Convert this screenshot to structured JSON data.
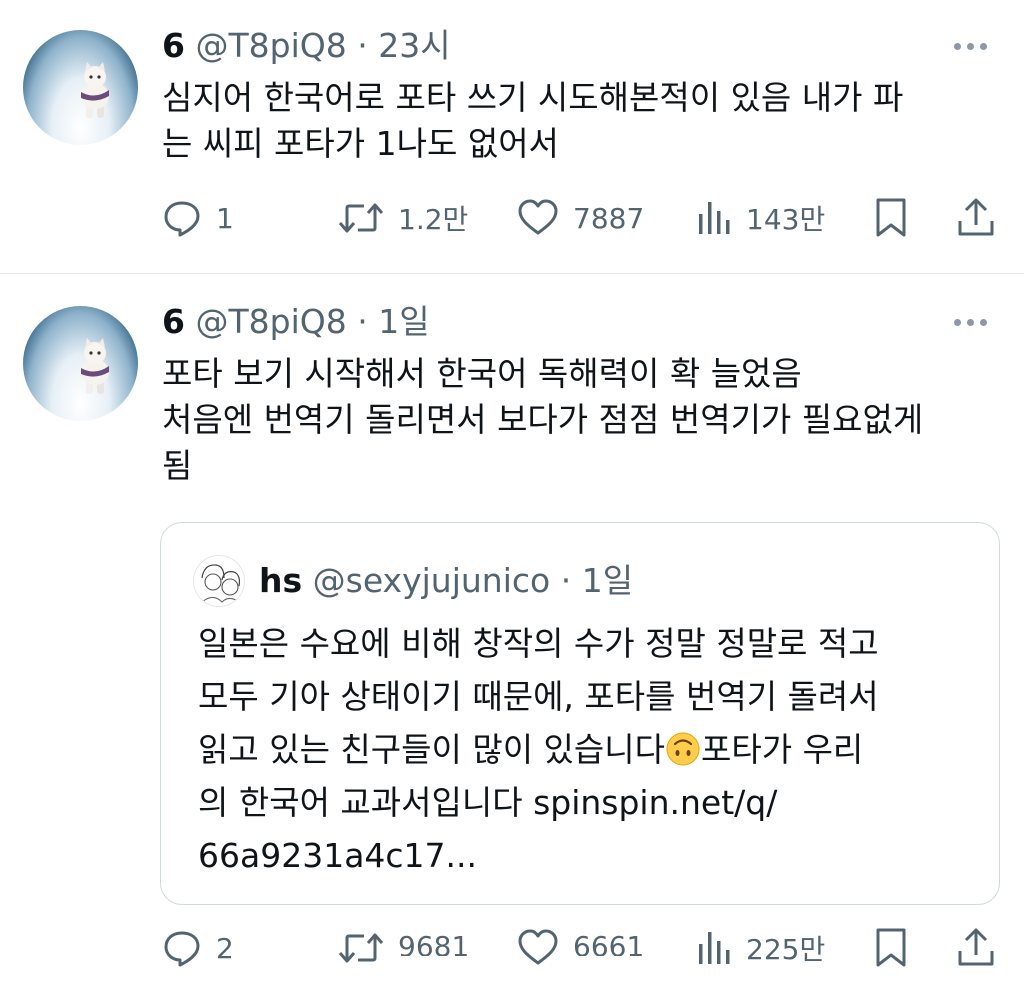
{
  "tweets": [
    {
      "author_name": "6",
      "handle": "@T8piQ8",
      "separator": "·",
      "time": "23시",
      "text_lines": [
        "심지어 한국어로 포타 쓰기 시도해본적이 있음 내가 파",
        "는 씨피 포타가 1나도 없어서"
      ],
      "actions": {
        "replies": "1",
        "retweets": "1.2만",
        "likes": "7887",
        "views": "143만"
      }
    },
    {
      "author_name": "6",
      "handle": "@T8piQ8",
      "separator": "·",
      "time": "1일",
      "text_lines": [
        "포타 보기 시작해서 한국어 독해력이 확 늘었음",
        "처음엔 번역기 돌리면서 보다가 점점 번역기가 필요없게",
        "됨"
      ],
      "quote": {
        "author_name": "hs",
        "handle": "@sexyjujunico",
        "separator": "·",
        "time": "1일",
        "text_lines": [
          "일본은 수요에 비해 창작의 수가 정말 정말로 적고",
          "모두 기아 상태이기 때문에, 포타를 번역기 돌려서",
          "읽고 있는 친구들이 많이 있습니다",
          "포타가 우리",
          "의 한국어 교과서입니다 spinspin.net/q/",
          "66a9231a4c17..."
        ]
      },
      "actions": {
        "replies": "2",
        "retweets": "9681",
        "likes": "6661",
        "views": "225만"
      }
    }
  ],
  "icons": {
    "reply": "speech-bubble-icon",
    "retweet": "retweet-arrows-icon",
    "like": "heart-icon",
    "views": "bar-chart-icon",
    "bookmark": "bookmark-icon",
    "share": "share-upload-icon",
    "more": "ellipsis-icon",
    "emoji": "upside-down-face-emoji"
  },
  "colors": {
    "text_primary": "#0f1419",
    "text_secondary": "#536471",
    "border": "#cfd9de",
    "divider": "#e6e9eb"
  }
}
